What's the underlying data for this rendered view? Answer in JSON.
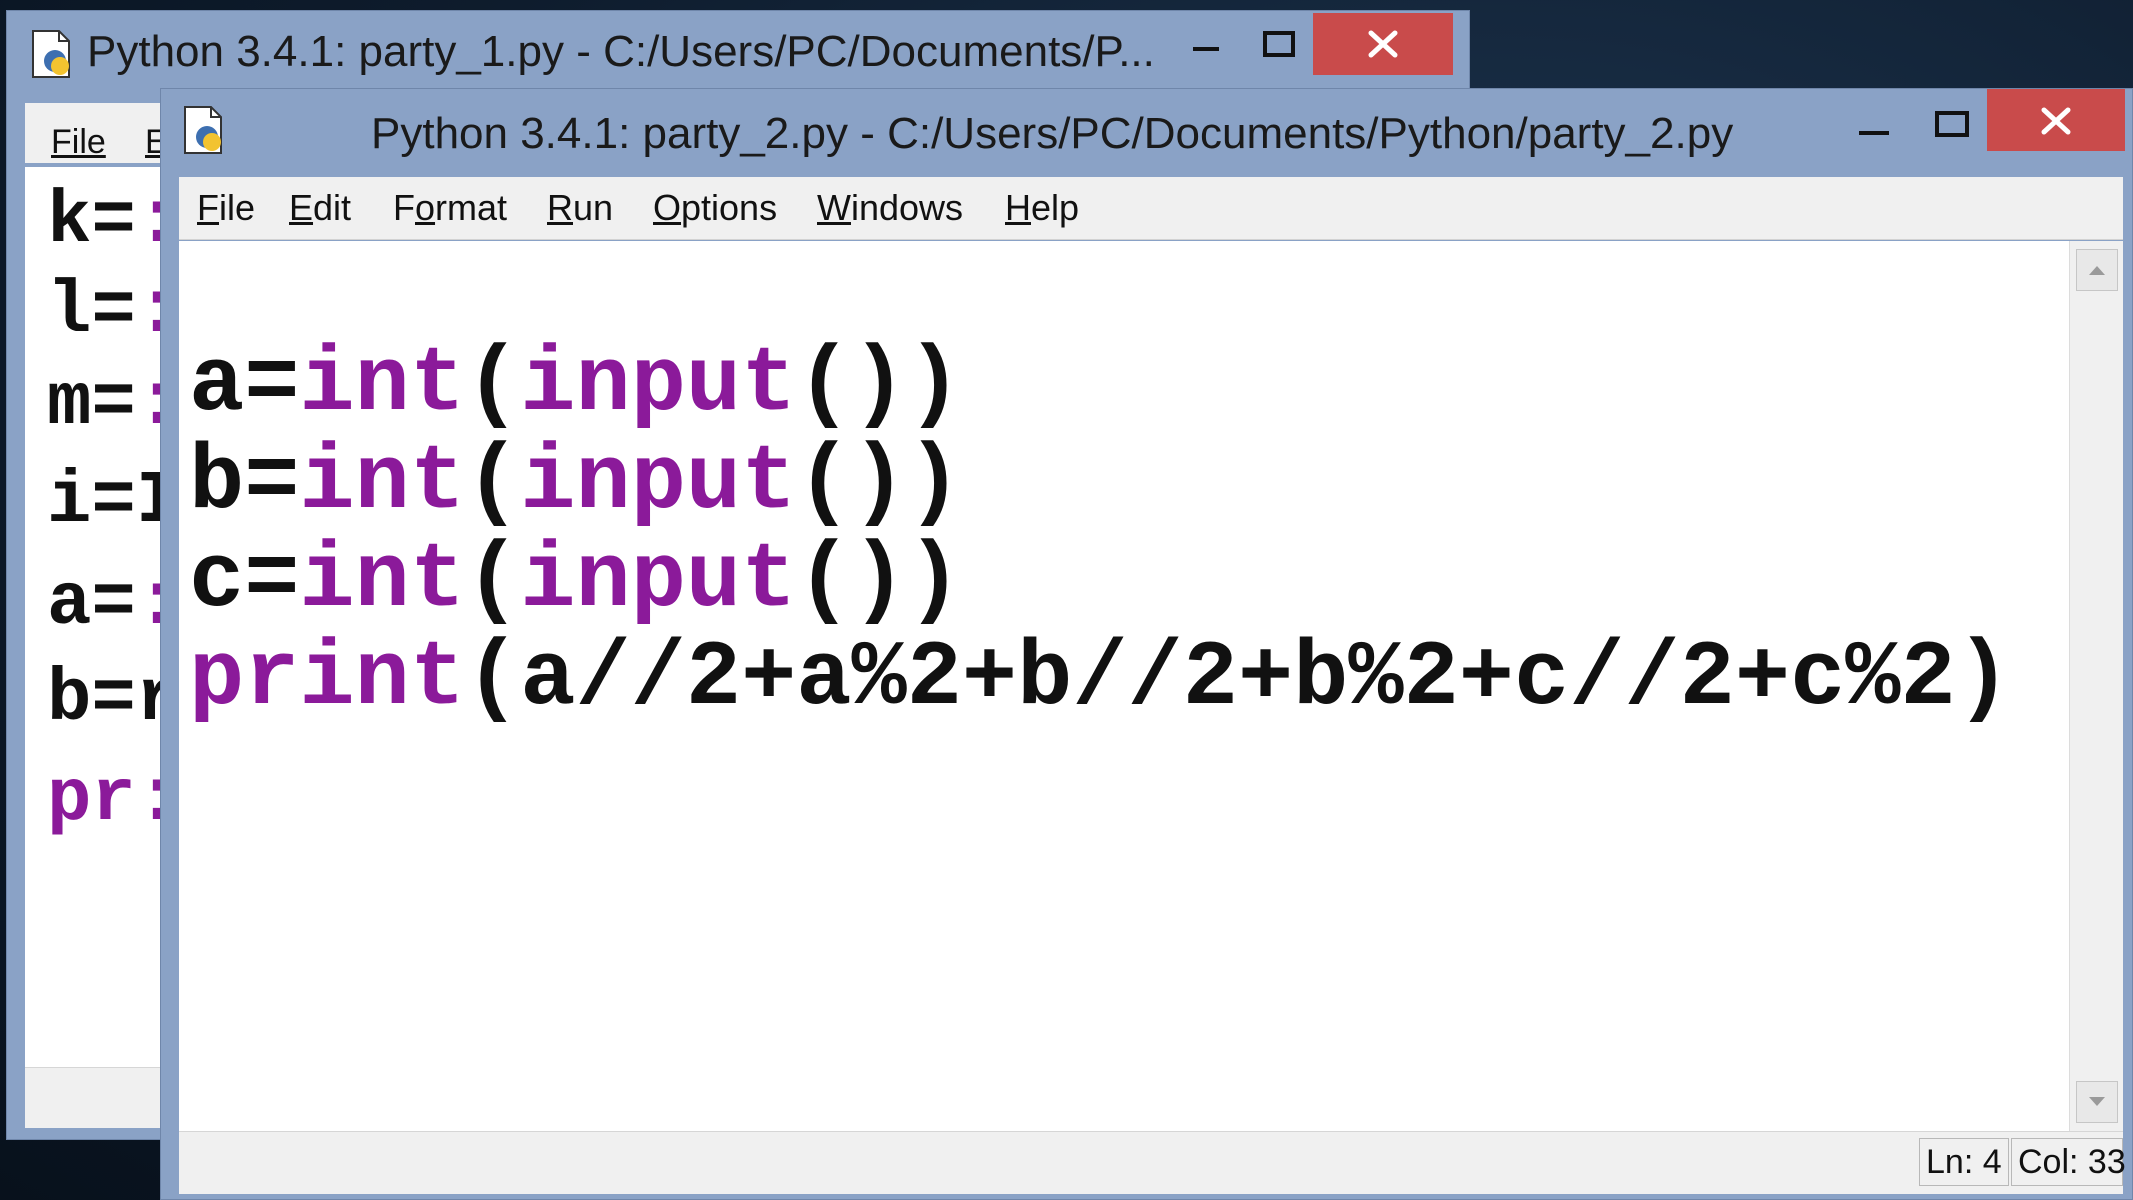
{
  "colors": {
    "keyword": "#8b1a9a",
    "close_button": "#c94b4b",
    "titlebar": "#8aa2c6"
  },
  "back_window": {
    "title": "Python 3.4.1: party_1.py - C:/Users/PC/Documents/P...",
    "menu": {
      "file": "File",
      "edit_partial": "E"
    },
    "code_lines": [
      {
        "var": "k",
        "op": "=",
        "cut": ":"
      },
      {
        "var": "l",
        "op": "=",
        "cut": ":"
      },
      {
        "var": "m",
        "op": "=",
        "cut": ":"
      },
      {
        "var": "i",
        "op": "=",
        "cut": "I"
      },
      {
        "var": "a",
        "op": "=",
        "cut": ":"
      },
      {
        "var": "b",
        "op": "=",
        "cut": "r"
      },
      {
        "var": "pr",
        "op": "",
        "cut": ":"
      }
    ]
  },
  "front_window": {
    "title": "Python 3.4.1: party_2.py - C:/Users/PC/Documents/Python/party_2.py",
    "menu": [
      {
        "u": "F",
        "rest": "ile"
      },
      {
        "u": "E",
        "rest": "dit"
      },
      {
        "pre": "F",
        "u": "o",
        "rest": "rmat"
      },
      {
        "u": "R",
        "rest": "un"
      },
      {
        "u": "O",
        "rest": "ptions"
      },
      {
        "u": "W",
        "rest": "indows"
      },
      {
        "u": "H",
        "rest": "elp"
      }
    ],
    "code": {
      "line1": {
        "pre": "a=",
        "kw1": "int",
        "p1": "(",
        "kw2": "input",
        "p2": "())"
      },
      "line2": {
        "pre": "b=",
        "kw1": "int",
        "p1": "(",
        "kw2": "input",
        "p2": "())"
      },
      "line3": {
        "pre": "c=",
        "kw1": "int",
        "p1": "(",
        "kw2": "input",
        "p2": "())"
      },
      "line4": {
        "kw1": "print",
        "rest": "(a//2+a%2+b//2+b%2+c//2+c%2)"
      }
    },
    "status": {
      "line": "Ln: 4",
      "col": "Col: 33"
    }
  }
}
